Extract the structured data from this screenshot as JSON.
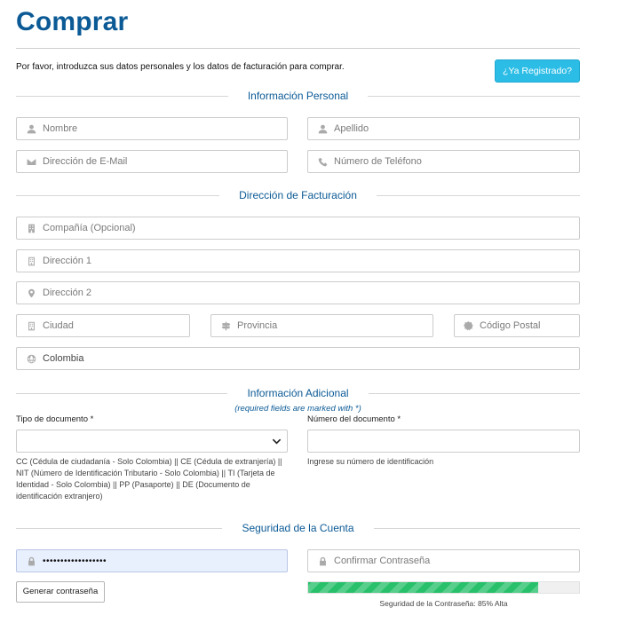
{
  "page": {
    "title": "Comprar",
    "intro": "Por favor, introduzca sus datos personales y los datos de facturación para comprar.",
    "registered_button": "¿Ya Registrado?"
  },
  "sections": {
    "personal": "Información Personal",
    "billing": "Dirección de Facturación",
    "additional": "Información Adicional",
    "security": "Seguridad de la Cuenta"
  },
  "personal": {
    "first_name": {
      "placeholder": "Nombre",
      "icon": "user-icon"
    },
    "last_name": {
      "placeholder": "Apellido",
      "icon": "user-icon"
    },
    "email": {
      "placeholder": "Dirección de E-Mail",
      "icon": "envelope-icon"
    },
    "phone": {
      "placeholder": "Número de Teléfono",
      "icon": "phone-icon"
    }
  },
  "billing": {
    "company": {
      "placeholder": "Compañía (Opcional)",
      "icon": "building-icon"
    },
    "address1": {
      "placeholder": "Dirección 1",
      "icon": "building-outline-icon"
    },
    "address2": {
      "placeholder": "Dirección 2",
      "icon": "map-marker-icon"
    },
    "city": {
      "placeholder": "Ciudad",
      "icon": "building-outline-icon"
    },
    "state": {
      "placeholder": "Provincia",
      "icon": "signpost-icon"
    },
    "postcode": {
      "placeholder": "Código Postal",
      "icon": "certificate-icon"
    },
    "country": {
      "value": "Colombia",
      "icon": "globe-icon"
    }
  },
  "additional": {
    "required_note": "(required fields are marked with *)",
    "doc_type_label": "Tipo de documento *",
    "doc_type_value": "",
    "doc_type_help": "CC (Cédula de ciudadanía - Solo Colombia) || CE (Cédula de extranjería) || NIT (Número de Identificación Tributario - Solo Colombia) || TI (Tarjeta de Identidad - Solo Colombia) || PP (Pasaporte) || DE (Documento de identificación extranjero)",
    "doc_number_label": "Número del documento *",
    "doc_number_value": "",
    "doc_number_help": "Ingrese su número de identificación"
  },
  "security": {
    "password_value": "••••••••••••••••••",
    "confirm_placeholder": "Confirmar Contraseña",
    "generate_button": "Generar contraseña",
    "strength_text": "Seguridad de la Contraseña: 85% Alta",
    "strength_percent": 85,
    "strength_color": "#28c06a"
  },
  "colors": {
    "title": "#0b5a96",
    "accent_button": "#2bbde6",
    "password_fill": "#e8effd"
  }
}
